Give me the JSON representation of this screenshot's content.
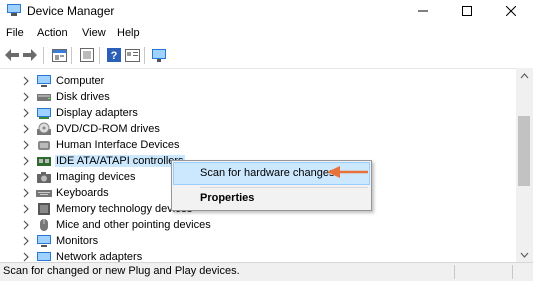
{
  "window": {
    "title": "Device Manager",
    "minimize_glyph": "—",
    "maximize_glyph": "☐",
    "close_glyph": "✕"
  },
  "menu": [
    "File",
    "Action",
    "View",
    "Help"
  ],
  "toolbar": {
    "icons": [
      "back-icon",
      "forward-icon",
      "properties-icon",
      "update-driver-icon",
      "help-icon",
      "show-hidden-icon",
      "scan-monitor-icon"
    ]
  },
  "tree": {
    "items": [
      {
        "label": "Computer",
        "icon": "computer-icon"
      },
      {
        "label": "Disk drives",
        "icon": "disk-drive-icon"
      },
      {
        "label": "Display adapters",
        "icon": "display-adapter-icon"
      },
      {
        "label": "DVD/CD-ROM drives",
        "icon": "dvd-drive-icon"
      },
      {
        "label": "Human Interface Devices",
        "icon": "hid-icon"
      },
      {
        "label": "IDE ATA/ATAPI controllers",
        "icon": "ide-controller-icon",
        "selected": true
      },
      {
        "label": "Imaging devices",
        "icon": "camera-icon"
      },
      {
        "label": "Keyboards",
        "icon": "keyboard-icon"
      },
      {
        "label": "Memory technology devices",
        "icon": "memory-icon"
      },
      {
        "label": "Mice and other pointing devices",
        "icon": "mouse-icon"
      },
      {
        "label": "Monitors",
        "icon": "monitor-icon"
      },
      {
        "label": "Network adapters",
        "icon": "network-adapter-icon"
      }
    ]
  },
  "context_menu": {
    "items": [
      "Scan for hardware changes",
      "Properties"
    ]
  },
  "statusbar": {
    "text": "Scan for changed or new Plug and Play devices."
  },
  "colors": {
    "selection": "#cce8ff",
    "annotation_arrow": "#e8733a",
    "icon_blue": "#2b78d3"
  }
}
